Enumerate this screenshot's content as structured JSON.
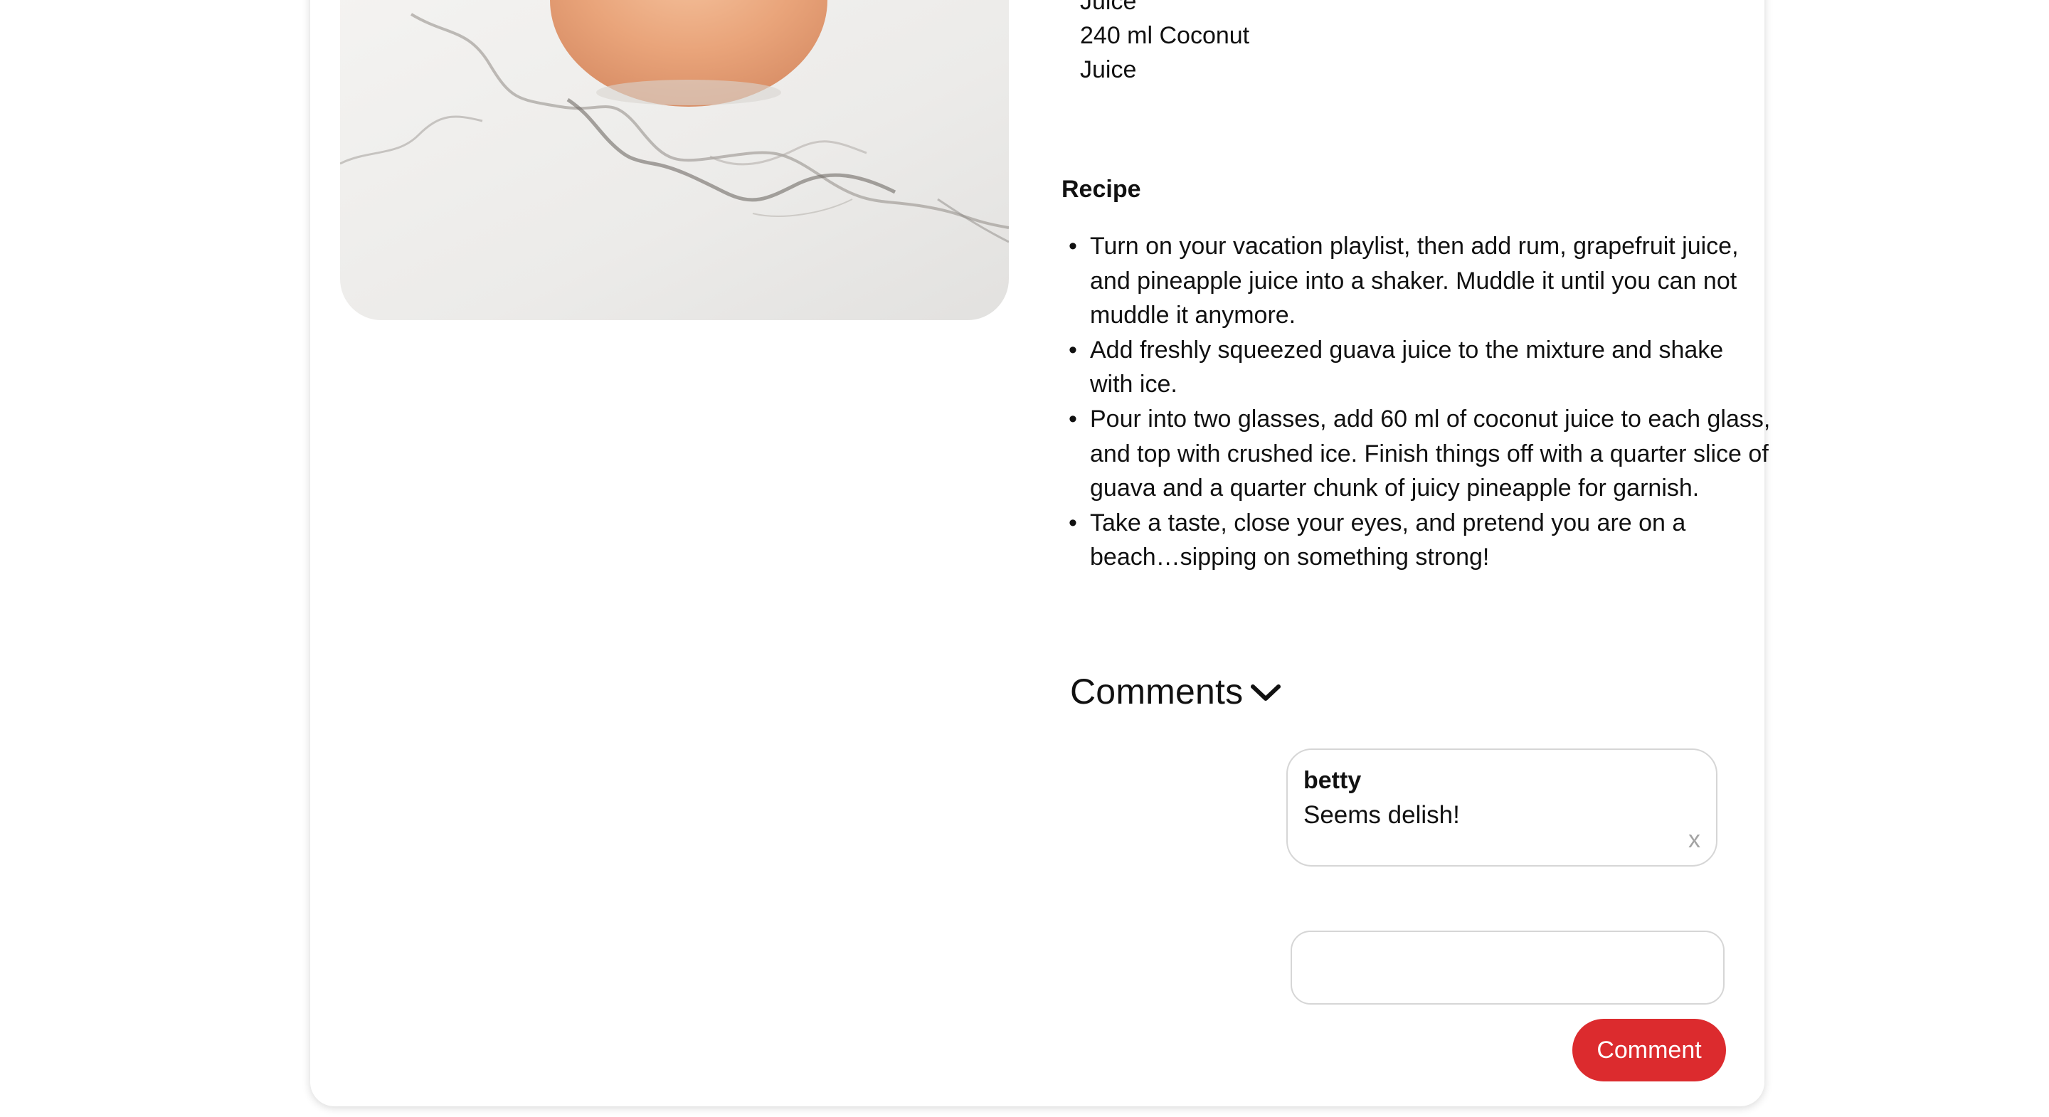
{
  "ingredients": {
    "lines": [
      "Juice",
      "240 ml Coconut",
      "Juice"
    ]
  },
  "recipe": {
    "heading": "Recipe",
    "steps": [
      "Turn on your vacation playlist, then add rum, grapefruit juice, and pineapple juice into a shaker. Muddle it until you can not muddle it anymore.",
      "Add freshly squeezed guava juice to the mixture and shake with ice.",
      "Pour into two glasses, add 60 ml of coconut juice to each glass, and top with crushed ice. Finish things off with a quarter slice of guava and a quarter chunk of juicy pineapple for garnish.",
      "Take a taste, close your eyes, and pretend you are on a beach…sipping on something strong!"
    ]
  },
  "comments": {
    "title": "Comments",
    "toggle_icon": "chevron-down-icon",
    "items": [
      {
        "author": "betty",
        "text": "Seems delish!",
        "delete_label": "x"
      }
    ],
    "input": {
      "value": "",
      "placeholder": ""
    },
    "submit_label": "Comment"
  },
  "colors": {
    "accent_button": "#dc2b2e",
    "border": "#d6d6d6",
    "delete_x": "#a3a3a3"
  }
}
